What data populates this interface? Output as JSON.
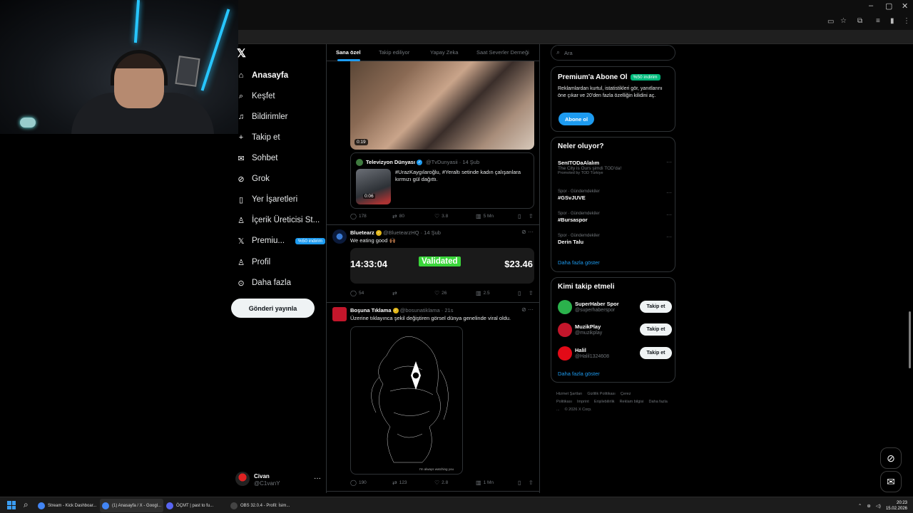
{
  "nav": {
    "items": [
      {
        "label": "Anasayfa",
        "icon": "home-icon",
        "glyph": "⌂",
        "active": true
      },
      {
        "label": "Keşfet",
        "icon": "search-icon",
        "glyph": "⌕"
      },
      {
        "label": "Bildirimler",
        "icon": "bell-icon",
        "glyph": "♫"
      },
      {
        "label": "Takip et",
        "icon": "follow-icon",
        "glyph": "+"
      },
      {
        "label": "Sohbet",
        "icon": "mail-icon",
        "glyph": "✉"
      },
      {
        "label": "Grok",
        "icon": "grok-icon",
        "glyph": "⊘"
      },
      {
        "label": "Yer İşaretleri",
        "icon": "bookmark-icon",
        "glyph": "▯"
      },
      {
        "label": "İçerik Üreticisi St...",
        "icon": "creator-icon",
        "glyph": "♙"
      },
      {
        "label": "Premiu...",
        "icon": "x-premium-icon",
        "glyph": "𝕏",
        "badge": "%50 indirim"
      },
      {
        "label": "Profil",
        "icon": "profile-icon",
        "glyph": "♙"
      },
      {
        "label": "Daha fazla",
        "icon": "more-icon",
        "glyph": "⊙"
      }
    ],
    "post_button": "Gönderi yayınla",
    "profile": {
      "name": "Civan",
      "handle": "@C1vanY"
    }
  },
  "tabs": [
    "Sana özel",
    "Takip ediliyor",
    "Yapay Zeka",
    "Saat Severler Derneği"
  ],
  "video": {
    "duration": "0:19"
  },
  "quote": {
    "name": "Televizyon Dünyası",
    "handle": "@TvDunyasii · 14 Şub",
    "text": "#UrazKaygılaroğlu, #Yeraltı setinde kadın çalışanlara kırmızı gül dağıttı.",
    "thumb_duration": "0:06"
  },
  "tweet1_actions": {
    "reply": "178",
    "repost": "80",
    "like": "3.8",
    "views": "5 Mn"
  },
  "tweet2": {
    "name": "Bluetearz",
    "handle": "@BluetearzHQ · 14 Şub",
    "text": "We eating good 🙌🏾",
    "time": "14:33:04",
    "status": "Validated",
    "amount": "$23.46",
    "actions": {
      "reply": "54",
      "repost": "",
      "like": "26",
      "views": "2.5"
    }
  },
  "tweet3": {
    "name": "Boşuna Tıklama",
    "handle": "@bosunatiklama · 21s",
    "text": "Üzerine tıklayınca şekil değiştiren görsel dünya genelinde viral oldu.",
    "caption": "I'm always watching you",
    "actions": {
      "reply": "190",
      "repost": "123",
      "like": "2.8",
      "views": "1 Mn"
    }
  },
  "right": {
    "search_placeholder": "Ara",
    "premium": {
      "title": "Premium'a Abone Ol",
      "badge": "%50 indirim",
      "body": "Reklamlardan kurtul, istatistikleri gör, yanıtlarını öne çıkar ve 20'den fazla özelliğin kilidini aç.",
      "button": "Abone ol"
    },
    "trends": {
      "title": "Neler oluyor?",
      "items": [
        {
          "meta": "",
          "title": "SenITODaAlalım",
          "extra": "The City is Ours şimdi TOD'da!",
          "extra2": "Promoted by TOD Türkiye"
        },
        {
          "meta": "Spor · Gündemdekiler",
          "title": "#GSvJUVE"
        },
        {
          "meta": "Spor · Gündemdekiler",
          "title": "#Bursaspor"
        },
        {
          "meta": "Spor · Gündemdekiler",
          "title": "Derin Talu"
        }
      ],
      "more": "Daha fazla göster"
    },
    "who": {
      "title": "Kimi takip etmeli",
      "items": [
        {
          "name": "SuperHaber Spor",
          "handle": "@superhaberspor",
          "button": "Takip et",
          "color": "#2bb24c"
        },
        {
          "name": "MuzikPlay",
          "handle": "@muzikplay",
          "button": "Takip et",
          "color": "#c3162b"
        },
        {
          "name": "Halil",
          "handle": "@Halil1324608",
          "button": "Takip et",
          "color": "#e30a17"
        }
      ],
      "more": "Daha fazla göster"
    },
    "footer": [
      "Hizmet Şartları",
      "Gizlilik Politikası",
      "Çerez Politikası",
      "Imprint",
      "Erişilebilirlik",
      "Reklam bilgisi",
      "Daha fazla ...",
      "© 2026 X Corp."
    ]
  },
  "taskbar": {
    "apps": [
      {
        "label": "Stream - Kick Dashboar...",
        "color": "#4285f4"
      },
      {
        "label": "(1) Anasayfa / X - Googl...",
        "color": "#4285f4",
        "active": true
      },
      {
        "label": "ÖÇMT | past to fu...",
        "color": "#5865f2"
      },
      {
        "label": "OBS 32.0.4 - Profil: İsim...",
        "color": "#444"
      }
    ],
    "time": "20:23",
    "date": "15.02.2026"
  }
}
